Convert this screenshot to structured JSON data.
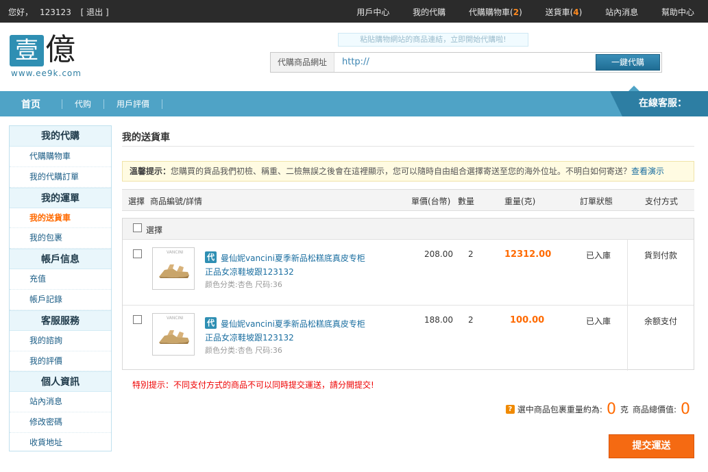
{
  "topbar": {
    "greeting": "您好，",
    "username": "123123",
    "logout": "[ 退出 ]",
    "links": {
      "user_center": "用戶中心",
      "my_purchase": "我的代購",
      "cart_label": "代購購物車(",
      "cart_count": "2",
      "ship_label": "送貨車(",
      "ship_count": "4",
      "close_paren": ")",
      "messages": "站內消息",
      "help": "幫助中心"
    }
  },
  "header": {
    "logo_char1": "壹",
    "logo_char2": "億",
    "logo_url": "www.ee9k.com",
    "tip": "粘貼購物網站的商品連結，立即開始代購啦!",
    "search_label": "代購商品網址",
    "search_value": "http://",
    "search_button": "一鍵代購"
  },
  "nav": {
    "home": "首页",
    "items": [
      "代购",
      "用戶評價"
    ],
    "service": "在線客服："
  },
  "sidebar": {
    "sections": [
      {
        "title": "我的代購",
        "items": [
          "代購購物車",
          "我的代購訂單"
        ]
      },
      {
        "title": "我的運單",
        "items": [
          "我的送貨車",
          "我的包裹"
        ]
      },
      {
        "title": "帳戶信息",
        "items": [
          "充值",
          "帳戶記錄"
        ]
      },
      {
        "title": "客服服務",
        "items": [
          "我的諮詢",
          "我的評價"
        ]
      },
      {
        "title": "個人資訊",
        "items": [
          "站內消息",
          "修改密碼",
          "收貨地址"
        ]
      }
    ],
    "active_item": "我的送貨車"
  },
  "main": {
    "title": "我的送貨車",
    "notice_label": "溫馨提示：",
    "notice_text": "您購買的貨品我們初檢、稱重、二檢無誤之後會在這裡顯示，您可以隨時自由組合選擇寄送至您的海外位址。不明白如何寄送？",
    "notice_link": "查看演示",
    "columns": {
      "select": "選擇",
      "product": "商品編號/詳情",
      "price": "單價(台幣)",
      "qty": "數量",
      "weight": "重量(克)",
      "status": "訂單狀態",
      "payment": "支付方式"
    },
    "select_all": "選擇",
    "rows": [
      {
        "badge": "代",
        "thumb_brand": "VANCINI",
        "name": "曼仙妮vancini夏季新品松糕底真皮专柜正品女凉鞋坡跟123132",
        "spec": "颜色分类:杏色 尺码:36",
        "price": "208.00",
        "qty": "2",
        "weight": "12312.00",
        "status": "已入庫",
        "payment": "貨到付款"
      },
      {
        "badge": "代",
        "thumb_brand": "VANCINI",
        "name": "曼仙妮vancini夏季新品松糕底真皮专柜正品女凉鞋坡跟123132",
        "spec": "颜色分类:杏色 尺码:36",
        "price": "188.00",
        "qty": "2",
        "weight": "100.00",
        "status": "已入庫",
        "payment": "余额支付"
      }
    ],
    "warning": "特別提示：不同支付方式的商品不可以同時提交運送，請分開提交!",
    "summary": {
      "icon": "?",
      "weight_label": "選中商品包裹重量約為:",
      "weight_value": "0",
      "weight_unit": "克",
      "value_label": "商品總價值:",
      "value_value": "0"
    },
    "submit": "提交運送"
  },
  "colors": {
    "accent_blue": "#4fa3c6",
    "dark_blue": "#2d7ea3",
    "orange": "#ff6a00",
    "topbar": "#2b2b2b"
  }
}
